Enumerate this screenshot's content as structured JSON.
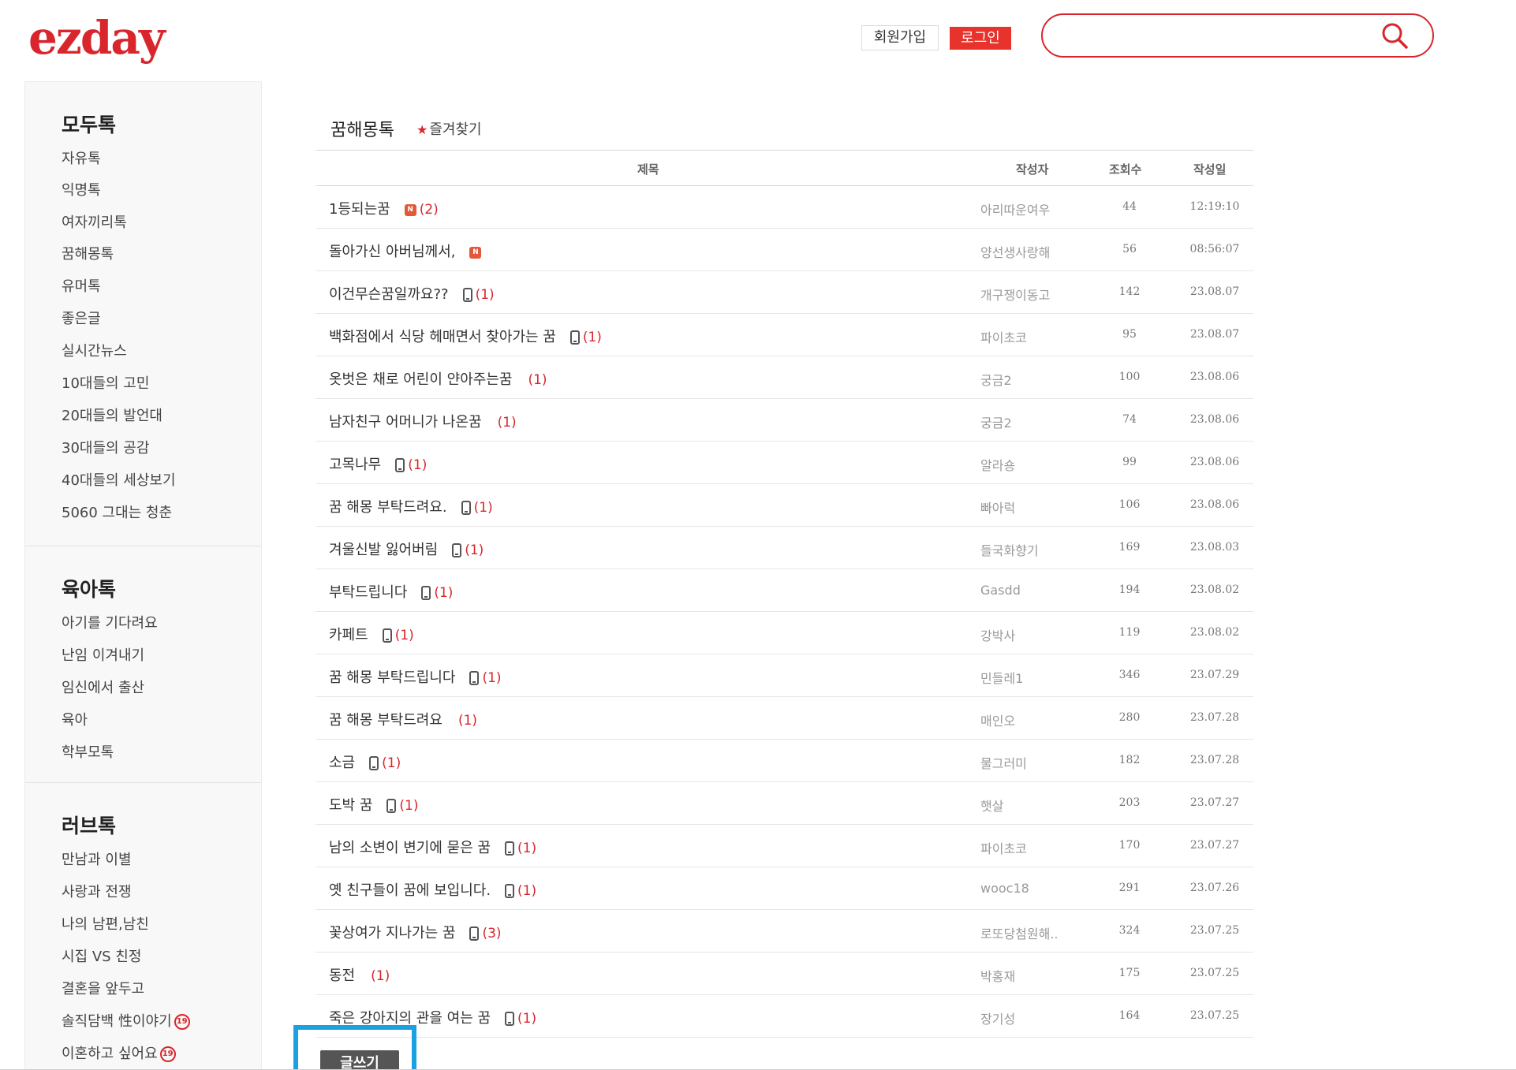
{
  "header": {
    "logo": "ezday",
    "join_label": "회원가입",
    "login_label": "로그인",
    "search_placeholder": ""
  },
  "sidebar": [
    {
      "title": "모두톡",
      "items": [
        "자유톡",
        "익명톡",
        "여자끼리톡",
        "꿈해몽톡",
        "유머톡",
        "좋은글",
        "실시간뉴스",
        "10대들의 고민",
        "20대들의 발언대",
        "30대들의 공감",
        "40대들의 세상보기",
        "5060 그대는 청춘"
      ]
    },
    {
      "title": "육아톡",
      "items": [
        "아기를 기다려요",
        "난임 이겨내기",
        "임신에서 출산",
        "육아",
        "학부모톡"
      ]
    },
    {
      "title": "러브톡",
      "items": [
        "만남과 이별",
        "사랑과 전쟁",
        "나의 남편,남친",
        "시집 VS 친정",
        "결혼을 앞두고",
        "솔직담백 性이야기",
        "이혼하고 싶어요"
      ],
      "badge": "19"
    }
  ],
  "board": {
    "title": "꿈해몽톡",
    "favorite_label": "즐겨찾기",
    "columns": {
      "title": "제목",
      "author": "작성자",
      "views": "조회수",
      "date": "작성일"
    },
    "rows": [
      {
        "title": "1등되는꿈",
        "icon": "new",
        "comments": "(2)",
        "author": "아리따운여우",
        "views": "44",
        "date": "12:19:10"
      },
      {
        "title": "돌아가신 아버님께서,",
        "icon": "new",
        "comments": "",
        "author": "양선생사랑해",
        "views": "56",
        "date": "08:56:07"
      },
      {
        "title": "이건무슨꿈일까요??",
        "icon": "mobile",
        "comments": "(1)",
        "author": "개구쟁이동고",
        "views": "142",
        "date": "23.08.07"
      },
      {
        "title": "백화점에서 식당 헤매면서 찾아가는 꿈",
        "icon": "mobile",
        "comments": "(1)",
        "author": "파이초코",
        "views": "95",
        "date": "23.08.07"
      },
      {
        "title": "옷벗은 채로 어린이 얀아주는꿈",
        "icon": "",
        "comments": "(1)",
        "author": "궁금2",
        "views": "100",
        "date": "23.08.06"
      },
      {
        "title": "남자친구 어머니가 나온꿈",
        "icon": "",
        "comments": "(1)",
        "author": "궁금2",
        "views": "74",
        "date": "23.08.06"
      },
      {
        "title": "고목나무",
        "icon": "mobile",
        "comments": "(1)",
        "author": "알라숑",
        "views": "99",
        "date": "23.08.06"
      },
      {
        "title": "꿈 해몽 부탁드려요.",
        "icon": "mobile",
        "comments": "(1)",
        "author": "빠아럭",
        "views": "106",
        "date": "23.08.06"
      },
      {
        "title": "겨울신발 잃어버림",
        "icon": "mobile",
        "comments": "(1)",
        "author": "들국화향기",
        "views": "169",
        "date": "23.08.03"
      },
      {
        "title": "부탁드립니다",
        "icon": "mobile",
        "comments": "(1)",
        "author": "Gasdd",
        "views": "194",
        "date": "23.08.02"
      },
      {
        "title": "카페트",
        "icon": "mobile",
        "comments": "(1)",
        "author": "강박사",
        "views": "119",
        "date": "23.08.02"
      },
      {
        "title": "꿈 해몽 부탁드립니다",
        "icon": "mobile",
        "comments": "(1)",
        "author": "민들레1",
        "views": "346",
        "date": "23.07.29"
      },
      {
        "title": "꿈 해몽 부탁드려요",
        "icon": "",
        "comments": "(1)",
        "author": "매인오",
        "views": "280",
        "date": "23.07.28"
      },
      {
        "title": "소금",
        "icon": "mobile",
        "comments": "(1)",
        "author": "물그러미",
        "views": "182",
        "date": "23.07.28"
      },
      {
        "title": "도박 꿈",
        "icon": "mobile",
        "comments": "(1)",
        "author": "햇살",
        "views": "203",
        "date": "23.07.27"
      },
      {
        "title": "남의 소변이 변기에 묻은 꿈",
        "icon": "mobile",
        "comments": "(1)",
        "author": "파이초코",
        "views": "170",
        "date": "23.07.27"
      },
      {
        "title": "옛 친구들이 꿈에 보입니다.",
        "icon": "mobile",
        "comments": "(1)",
        "author": "wooc18",
        "views": "291",
        "date": "23.07.26"
      },
      {
        "title": "꽃상여가 지나가는 꿈",
        "icon": "mobile",
        "comments": "(3)",
        "author": "로또당첨원해..",
        "views": "324",
        "date": "23.07.25"
      },
      {
        "title": "동전",
        "icon": "",
        "comments": "(1)",
        "author": "박홍재",
        "views": "175",
        "date": "23.07.25"
      },
      {
        "title": "죽은 강아지의 관을 여는 꿈",
        "icon": "mobile",
        "comments": "(1)",
        "author": "장기성",
        "views": "164",
        "date": "23.07.25"
      }
    ],
    "write_label": "글쓰기"
  },
  "colors": {
    "brand": "#d8262c",
    "highlight": "#1ba1e2"
  }
}
